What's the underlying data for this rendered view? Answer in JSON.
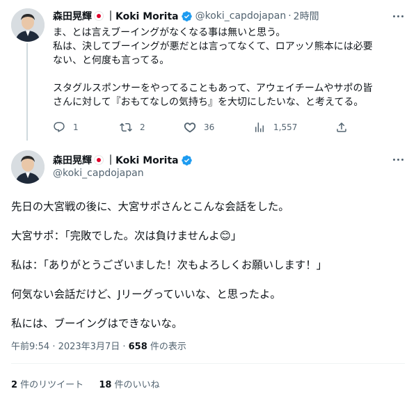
{
  "reply": {
    "display_name": "森田晃輝",
    "name_suffix": "｜Koki Morita",
    "handle": "@koki_capdojapan",
    "separator": "·",
    "time": "2時間",
    "lines": [
      "ま、とは言えブーイングがなくなる事は無いと思う。",
      "私は、決してブーイングが悪だとは言ってなくて、ロアッソ熊本には必要",
      "ない、と何度も言ってる。",
      "",
      "スタグルスポンサーをやってることもあって、アウェイチームやサポの皆",
      "さんに対して『おもてなしの気持ち』を大切にしたいな、と考えてる。"
    ],
    "actions": {
      "reply_count": "1",
      "retweet_count": "2",
      "like_count": "36",
      "views_count": "1,557"
    }
  },
  "main": {
    "display_name": "森田晃輝",
    "name_suffix": "｜Koki Morita",
    "handle": "@koki_capdojapan",
    "paragraphs": [
      "先日の大宮戦の後に、大宮サポさんとこんな会話をした。",
      "大宮サポ：「完敗でした。次は負けませんよ😊」",
      "私は：「ありがとうございました！次もよろしくお願いします！」",
      "何気ない会話だけど、Jリーグっていいな、と思ったよ。",
      "私には、ブーイングはできないな。"
    ],
    "timestamp": "午前9:54 · 2023年3月7日 · ",
    "views_number": "658",
    "views_label": " 件の表示",
    "retweets_number": "2",
    "retweets_label": " 件のリツイート",
    "likes_number": "18",
    "likes_label": " 件のいいね"
  },
  "colors": {
    "text": "#0f1419",
    "secondary": "#536471",
    "verified": "#1d9bf0",
    "divider": "#eff3f4",
    "flag_red": "#e0002a"
  },
  "icons": [
    "more-icon",
    "verified-icon",
    "flag-icon",
    "reply-icon",
    "retweet-icon",
    "like-icon",
    "views-icon",
    "share-icon"
  ]
}
